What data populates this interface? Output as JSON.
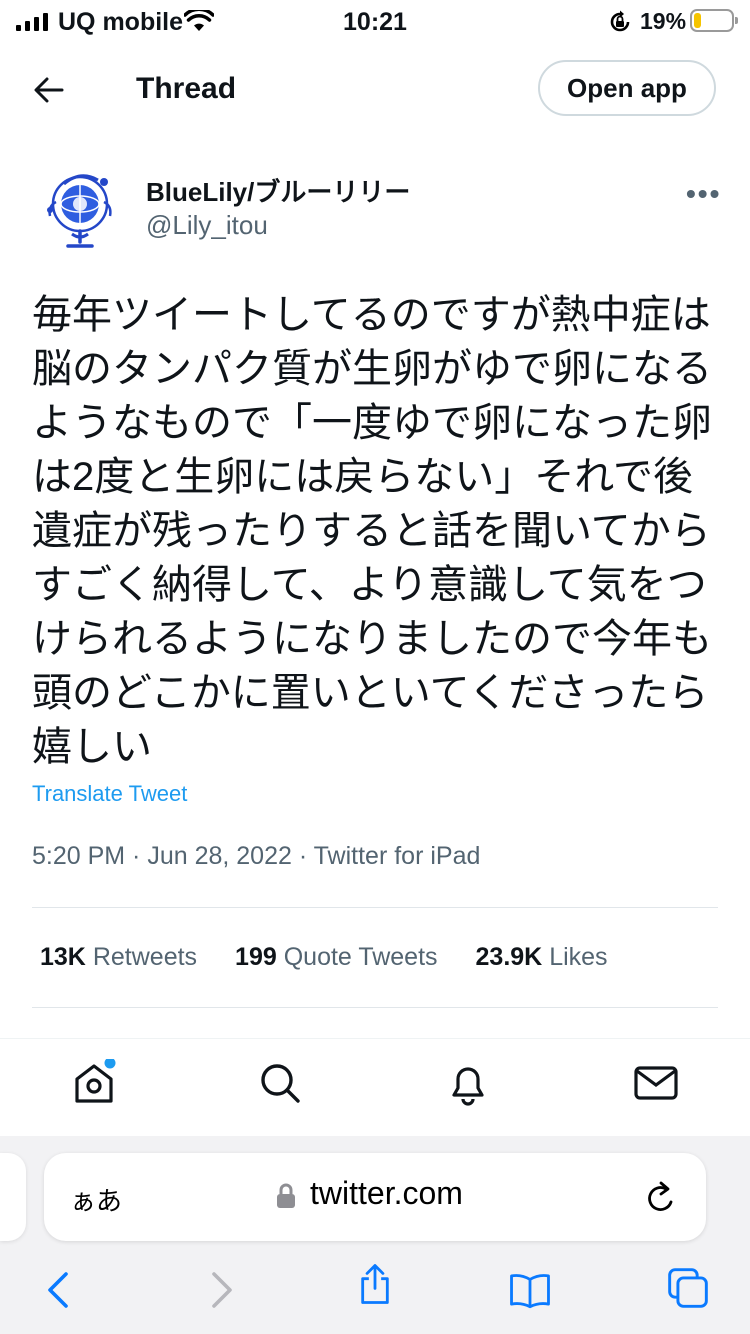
{
  "status_bar": {
    "carrier": "UQ mobile",
    "time": "10:21",
    "battery": "19%",
    "battery_level": 0.19
  },
  "header": {
    "title": "Thread",
    "open_app_label": "Open app"
  },
  "tweet": {
    "display_name": "BlueLily/ブルーリリー",
    "handle": "@Lily_itou",
    "text": "毎年ツイートしてるのですが熱中症は脳のタンパク質が生卵がゆで卵になるようなもので「一度ゆで卵になった卵は2度と生卵には戻らない」それで後遺症が残ったりすると話を聞いてからすごく納得して、より意識して気をつけられるようになりましたので今年も頭のどこかに置いといてくださったら嬉しい",
    "translate_label": "Translate Tweet",
    "meta": "5:20 PM · Jun 28, 2022 · Twitter for iPad",
    "stats": {
      "retweets_count": "13K",
      "retweets_label": "Retweets",
      "quotes_count": "199",
      "quotes_label": "Quote Tweets",
      "likes_count": "23.9K",
      "likes_label": "Likes"
    }
  },
  "browser": {
    "text_size_label": "ぁあ",
    "domain": "twitter.com"
  },
  "colors": {
    "accent": "#1d9bf0",
    "text": "#0f1419",
    "muted": "#536471",
    "ios_blue": "#0a7aff"
  },
  "icons": {
    "nav": [
      "home-icon",
      "search-icon",
      "notifications-icon",
      "messages-icon"
    ],
    "toolbar": [
      "back-icon",
      "forward-icon",
      "share-icon",
      "bookmarks-icon",
      "tabs-icon"
    ]
  }
}
